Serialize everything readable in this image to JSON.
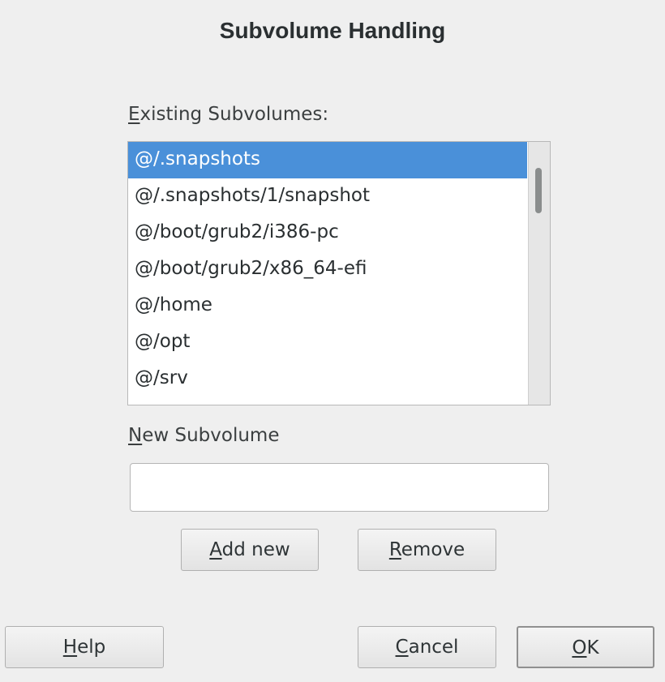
{
  "dialog": {
    "title": "Subvolume Handling"
  },
  "existing": {
    "label_mnemonic": "E",
    "label_rest": "xisting Subvolumes:",
    "items": [
      "@/.snapshots",
      "@/.snapshots/1/snapshot",
      "@/boot/grub2/i386-pc",
      "@/boot/grub2/x86_64-efi",
      "@/home",
      "@/opt",
      "@/srv"
    ],
    "selected_index": 0
  },
  "new_subvolume": {
    "label_mnemonic": "N",
    "label_rest": "ew Subvolume",
    "value": ""
  },
  "buttons": {
    "add_mnemonic": "A",
    "add_rest": "dd new",
    "remove_mnemonic": "R",
    "remove_rest": "emove",
    "help_mnemonic": "H",
    "help_rest": "elp",
    "cancel_mnemonic": "C",
    "cancel_rest": "ancel",
    "ok_mnemonic": "O",
    "ok_rest": "K"
  },
  "colors": {
    "selection": "#4a90d9",
    "background": "#efefef"
  }
}
